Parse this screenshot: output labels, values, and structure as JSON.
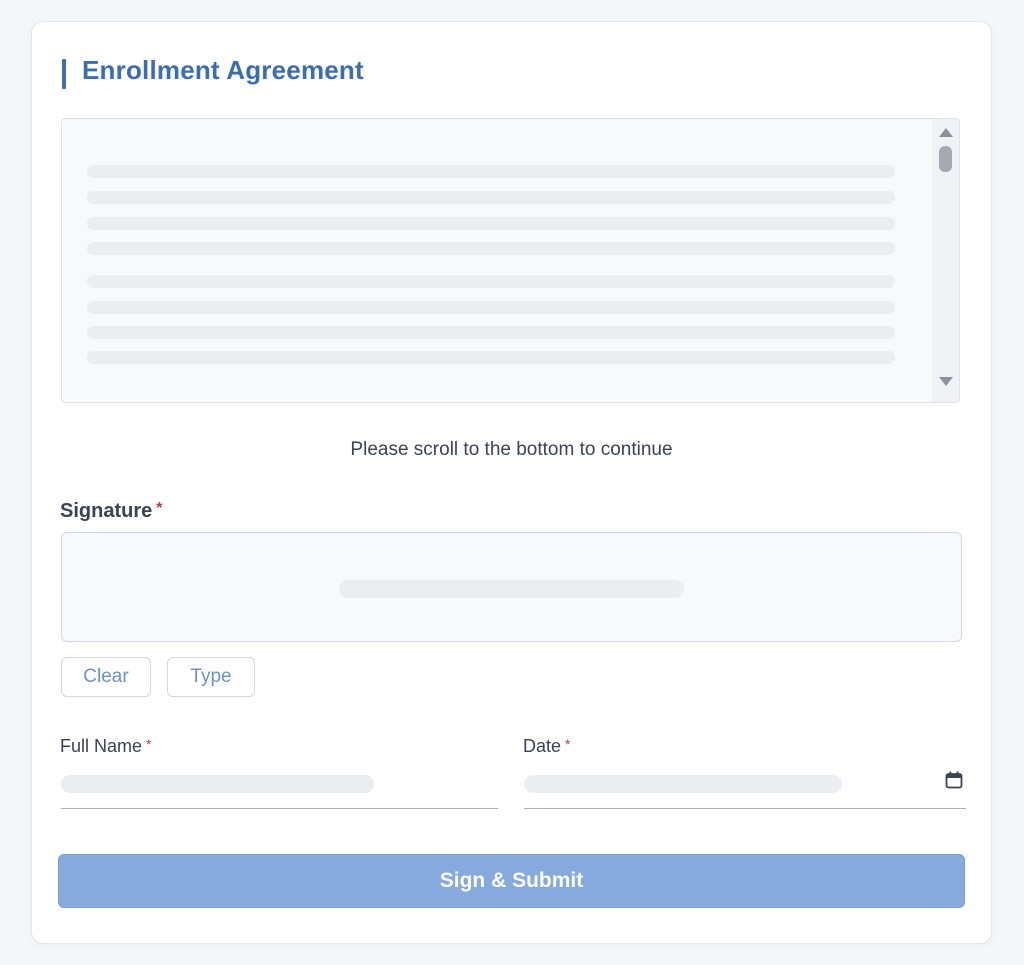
{
  "form": {
    "title": "Enrollment Agreement",
    "scroll_hint": "Please scroll to the bottom to continue",
    "signature": {
      "label": "Signature",
      "required_mark": "*"
    },
    "buttons": {
      "clear": "Clear",
      "type": "Type",
      "submit": "Sign & Submit"
    },
    "full_name": {
      "label": "Full Name",
      "required_mark": "*"
    },
    "date": {
      "label": "Date",
      "required_mark": "*"
    }
  },
  "colors": {
    "accent": "#3a6db3",
    "submit_button": "#86a9de",
    "required": "#c0394b"
  },
  "icons": {
    "calendar": "calendar-icon"
  }
}
